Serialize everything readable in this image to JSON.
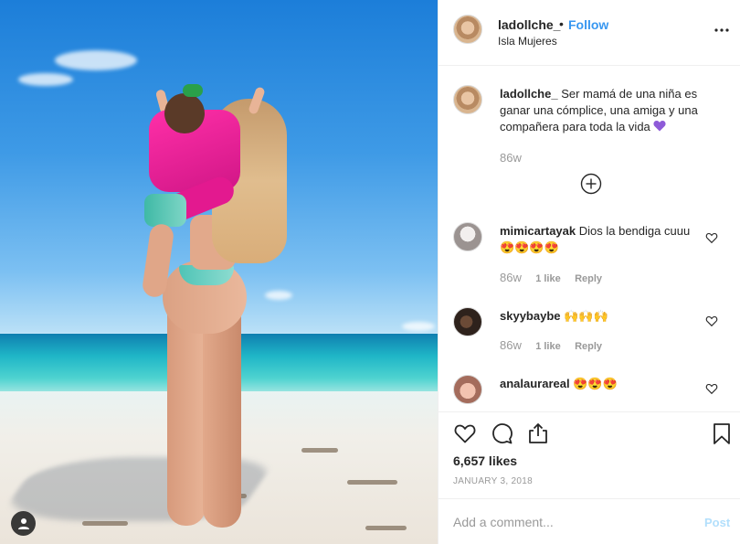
{
  "post": {
    "username": "ladollche_",
    "separator": "•",
    "follow_label": "Follow",
    "location": "Isla Mujeres",
    "more_icon": "ellipsis-icon"
  },
  "caption": {
    "username": "ladollche_",
    "text": "Ser mamá de una niña es ganar una cómplice, una amiga y una compañera para toda la vida",
    "emoji": "purple-heart",
    "time": "86w",
    "load_more_icon": "plus-circle-icon"
  },
  "comments": [
    {
      "username": "mimicartayak",
      "text": "Dios la bendiga cuuu 😍😍😍😍",
      "time": "86w",
      "likes": "1 like",
      "reply": "Reply"
    },
    {
      "username": "skyybaybe",
      "text": "🙌🙌🙌",
      "time": "86w",
      "likes": "1 like",
      "reply": "Reply"
    },
    {
      "username": "analaurareal",
      "text": "😍😍😍",
      "time": "",
      "likes": "",
      "reply": ""
    }
  ],
  "actions": {
    "like_icon": "heart-icon",
    "comment_icon": "comment-icon",
    "share_icon": "share-icon",
    "save_icon": "bookmark-icon",
    "likes_text": "6,657 likes",
    "date": "January 3, 2018"
  },
  "add_comment": {
    "placeholder": "Add a comment...",
    "post_label": "Post"
  },
  "colors": {
    "link_blue": "#3897f0",
    "post_disabled": "#b2dffc",
    "muted_text": "#999999",
    "purple_heart": "#8e5bd8"
  }
}
